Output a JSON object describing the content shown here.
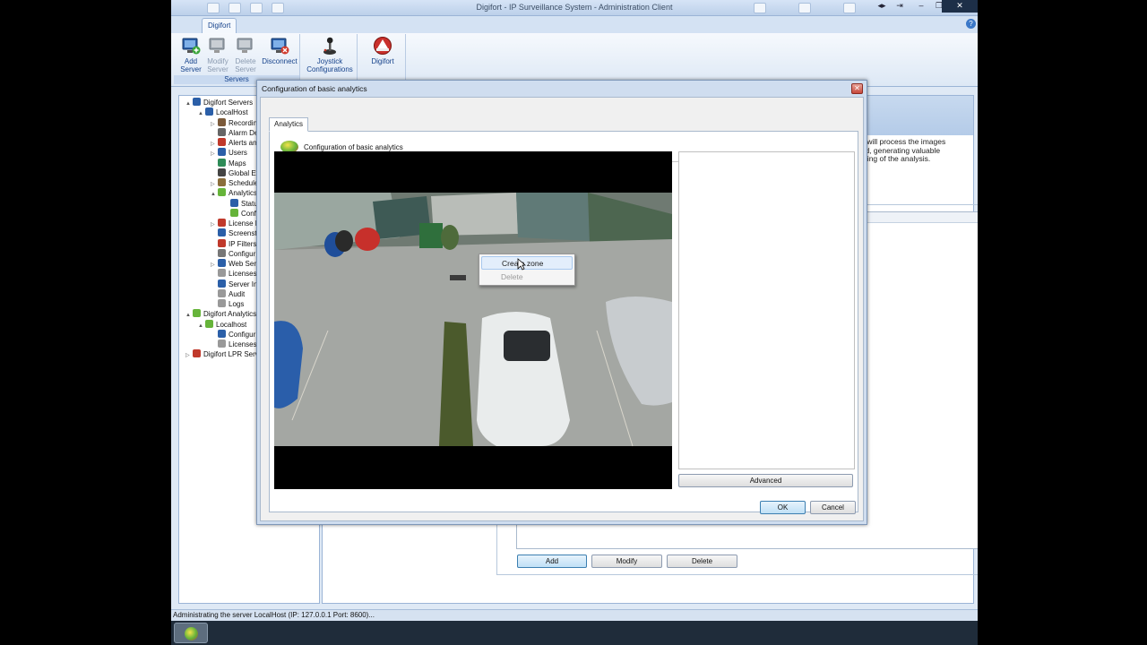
{
  "window": {
    "title": "Digifort - IP Surveillance System - Administration Client",
    "controls": {
      "minimize": "–",
      "restore": "❐",
      "close": "✕"
    }
  },
  "ribbon": {
    "active_tab": "Digifort",
    "help": "?",
    "groups": [
      {
        "label": "Servers",
        "buttons": [
          {
            "label_line1": "Add",
            "label_line2": "Server",
            "icon": "add-server-icon",
            "enabled": true
          },
          {
            "label_line1": "Modify",
            "label_line2": "Server",
            "icon": "modify-server-icon",
            "enabled": false
          },
          {
            "label_line1": "Delete",
            "label_line2": "Server",
            "icon": "delete-server-icon",
            "enabled": false
          },
          {
            "label_line1": "Disconnect",
            "label_line2": "",
            "icon": "disconnect-icon",
            "enabled": true
          }
        ]
      },
      {
        "label": "",
        "buttons": [
          {
            "label_line1": "Joystick",
            "label_line2": "Configurations",
            "icon": "joystick-icon",
            "enabled": true
          }
        ]
      },
      {
        "label": "",
        "buttons": [
          {
            "label_line1": "Digifort",
            "label_line2": "",
            "icon": "digifort-logo-icon",
            "enabled": true
          }
        ]
      }
    ]
  },
  "tree": {
    "items": [
      {
        "label": "Digifort Servers",
        "level": 0,
        "expander": "▲",
        "color": "#2b5fa8"
      },
      {
        "label": "LocalHost",
        "level": 1,
        "expander": "▲",
        "color": "#2b5fa8"
      },
      {
        "label": "Recordin",
        "level": 2,
        "expander": "▷",
        "color": "#7b5a3a"
      },
      {
        "label": "Alarm De",
        "level": 2,
        "expander": "",
        "color": "#666"
      },
      {
        "label": "Alerts an",
        "level": 2,
        "expander": "▷",
        "color": "#c0392b"
      },
      {
        "label": "Users",
        "level": 2,
        "expander": "▷",
        "color": "#2b5fa8"
      },
      {
        "label": "Maps",
        "level": 2,
        "expander": "",
        "color": "#2e8b57"
      },
      {
        "label": "Global Ev",
        "level": 2,
        "expander": "",
        "color": "#444"
      },
      {
        "label": "Schedule",
        "level": 2,
        "expander": "▷",
        "color": "#8a6d3b"
      },
      {
        "label": "Analytics",
        "level": 2,
        "expander": "▲",
        "color": "#66b43a"
      },
      {
        "label": "Statu",
        "level": 3,
        "expander": "",
        "color": "#2b5fa8"
      },
      {
        "label": "Conf",
        "level": 3,
        "expander": "",
        "color": "#66b43a"
      },
      {
        "label": "License F",
        "level": 2,
        "expander": "▷",
        "color": "#c0392b"
      },
      {
        "label": "Screenst",
        "level": 2,
        "expander": "",
        "color": "#2b5fa8"
      },
      {
        "label": "IP Filters",
        "level": 2,
        "expander": "",
        "color": "#c0392b"
      },
      {
        "label": "Configur",
        "level": 2,
        "expander": "",
        "color": "#777"
      },
      {
        "label": "Web Ser",
        "level": 2,
        "expander": "▷",
        "color": "#2b5fa8"
      },
      {
        "label": "Licenses",
        "level": 2,
        "expander": "",
        "color": "#999"
      },
      {
        "label": "Server In",
        "level": 2,
        "expander": "",
        "color": "#2b5fa8"
      },
      {
        "label": "Audit",
        "level": 2,
        "expander": "",
        "color": "#999"
      },
      {
        "label": "Logs",
        "level": 2,
        "expander": "",
        "color": "#999"
      },
      {
        "label": "Digifort Analytics",
        "level": 0,
        "expander": "▲",
        "color": "#66b43a"
      },
      {
        "label": "Localhost",
        "level": 1,
        "expander": "▲",
        "color": "#66b43a"
      },
      {
        "label": "Configur",
        "level": 2,
        "expander": "",
        "color": "#2b5fa8"
      },
      {
        "label": "Licenses",
        "level": 2,
        "expander": "",
        "color": "#999"
      },
      {
        "label": "Digifort LPR Serv",
        "level": 0,
        "expander": "▷",
        "color": "#c0392b"
      }
    ]
  },
  "main": {
    "description_line1": ", it will process the images",
    "description_line2": "hed, generating valuable",
    "description_line3": "itoring of the analysis.",
    "buttons": {
      "add": "Add",
      "modify": "Modify",
      "delete": "Delete"
    }
  },
  "dialog": {
    "title": "Configuration of basic analytics",
    "close": "✕",
    "tab": "Analytics",
    "header_title": "Configuration of basic analytics",
    "advanced": "Advanced",
    "ok": "OK",
    "cancel": "Cancel"
  },
  "context_menu": {
    "items": [
      {
        "label": "Create zone",
        "enabled": true
      },
      {
        "label": "Delete",
        "enabled": false
      }
    ]
  },
  "statusbar": {
    "text": "Administrating the server LocalHost (IP: 127.0.0.1 Port: 8600)..."
  },
  "colors": {
    "ribbon": "#dde8f5",
    "dialog": "#cfddef",
    "accent": "#15428b"
  }
}
